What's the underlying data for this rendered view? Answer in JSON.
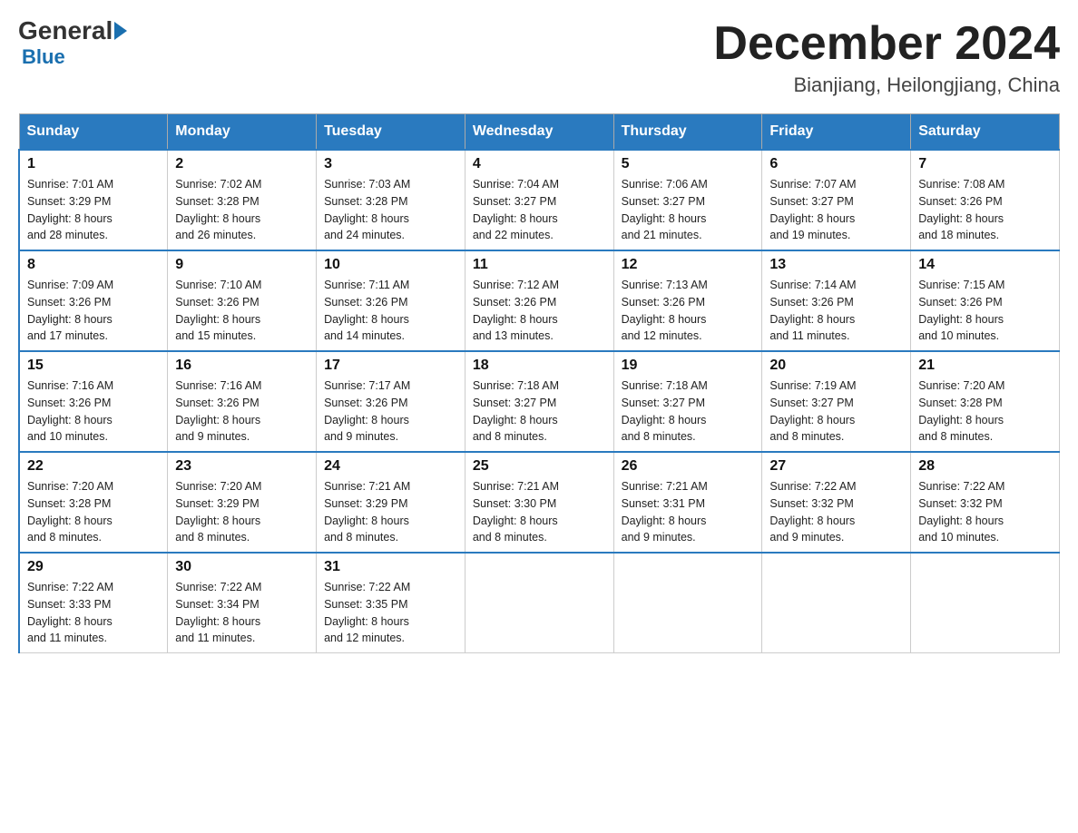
{
  "logo": {
    "general": "General",
    "blue": "Blue"
  },
  "header": {
    "title": "December 2024",
    "subtitle": "Bianjiang, Heilongjiang, China"
  },
  "days": [
    "Sunday",
    "Monday",
    "Tuesday",
    "Wednesday",
    "Thursday",
    "Friday",
    "Saturday"
  ],
  "weeks": [
    [
      {
        "day": "1",
        "sunrise": "7:01 AM",
        "sunset": "3:29 PM",
        "daylight": "8 hours and 28 minutes."
      },
      {
        "day": "2",
        "sunrise": "7:02 AM",
        "sunset": "3:28 PM",
        "daylight": "8 hours and 26 minutes."
      },
      {
        "day": "3",
        "sunrise": "7:03 AM",
        "sunset": "3:28 PM",
        "daylight": "8 hours and 24 minutes."
      },
      {
        "day": "4",
        "sunrise": "7:04 AM",
        "sunset": "3:27 PM",
        "daylight": "8 hours and 22 minutes."
      },
      {
        "day": "5",
        "sunrise": "7:06 AM",
        "sunset": "3:27 PM",
        "daylight": "8 hours and 21 minutes."
      },
      {
        "day": "6",
        "sunrise": "7:07 AM",
        "sunset": "3:27 PM",
        "daylight": "8 hours and 19 minutes."
      },
      {
        "day": "7",
        "sunrise": "7:08 AM",
        "sunset": "3:26 PM",
        "daylight": "8 hours and 18 minutes."
      }
    ],
    [
      {
        "day": "8",
        "sunrise": "7:09 AM",
        "sunset": "3:26 PM",
        "daylight": "8 hours and 17 minutes."
      },
      {
        "day": "9",
        "sunrise": "7:10 AM",
        "sunset": "3:26 PM",
        "daylight": "8 hours and 15 minutes."
      },
      {
        "day": "10",
        "sunrise": "7:11 AM",
        "sunset": "3:26 PM",
        "daylight": "8 hours and 14 minutes."
      },
      {
        "day": "11",
        "sunrise": "7:12 AM",
        "sunset": "3:26 PM",
        "daylight": "8 hours and 13 minutes."
      },
      {
        "day": "12",
        "sunrise": "7:13 AM",
        "sunset": "3:26 PM",
        "daylight": "8 hours and 12 minutes."
      },
      {
        "day": "13",
        "sunrise": "7:14 AM",
        "sunset": "3:26 PM",
        "daylight": "8 hours and 11 minutes."
      },
      {
        "day": "14",
        "sunrise": "7:15 AM",
        "sunset": "3:26 PM",
        "daylight": "8 hours and 10 minutes."
      }
    ],
    [
      {
        "day": "15",
        "sunrise": "7:16 AM",
        "sunset": "3:26 PM",
        "daylight": "8 hours and 10 minutes."
      },
      {
        "day": "16",
        "sunrise": "7:16 AM",
        "sunset": "3:26 PM",
        "daylight": "8 hours and 9 minutes."
      },
      {
        "day": "17",
        "sunrise": "7:17 AM",
        "sunset": "3:26 PM",
        "daylight": "8 hours and 9 minutes."
      },
      {
        "day": "18",
        "sunrise": "7:18 AM",
        "sunset": "3:27 PM",
        "daylight": "8 hours and 8 minutes."
      },
      {
        "day": "19",
        "sunrise": "7:18 AM",
        "sunset": "3:27 PM",
        "daylight": "8 hours and 8 minutes."
      },
      {
        "day": "20",
        "sunrise": "7:19 AM",
        "sunset": "3:27 PM",
        "daylight": "8 hours and 8 minutes."
      },
      {
        "day": "21",
        "sunrise": "7:20 AM",
        "sunset": "3:28 PM",
        "daylight": "8 hours and 8 minutes."
      }
    ],
    [
      {
        "day": "22",
        "sunrise": "7:20 AM",
        "sunset": "3:28 PM",
        "daylight": "8 hours and 8 minutes."
      },
      {
        "day": "23",
        "sunrise": "7:20 AM",
        "sunset": "3:29 PM",
        "daylight": "8 hours and 8 minutes."
      },
      {
        "day": "24",
        "sunrise": "7:21 AM",
        "sunset": "3:29 PM",
        "daylight": "8 hours and 8 minutes."
      },
      {
        "day": "25",
        "sunrise": "7:21 AM",
        "sunset": "3:30 PM",
        "daylight": "8 hours and 8 minutes."
      },
      {
        "day": "26",
        "sunrise": "7:21 AM",
        "sunset": "3:31 PM",
        "daylight": "8 hours and 9 minutes."
      },
      {
        "day": "27",
        "sunrise": "7:22 AM",
        "sunset": "3:32 PM",
        "daylight": "8 hours and 9 minutes."
      },
      {
        "day": "28",
        "sunrise": "7:22 AM",
        "sunset": "3:32 PM",
        "daylight": "8 hours and 10 minutes."
      }
    ],
    [
      {
        "day": "29",
        "sunrise": "7:22 AM",
        "sunset": "3:33 PM",
        "daylight": "8 hours and 11 minutes."
      },
      {
        "day": "30",
        "sunrise": "7:22 AM",
        "sunset": "3:34 PM",
        "daylight": "8 hours and 11 minutes."
      },
      {
        "day": "31",
        "sunrise": "7:22 AM",
        "sunset": "3:35 PM",
        "daylight": "8 hours and 12 minutes."
      },
      null,
      null,
      null,
      null
    ]
  ],
  "labels": {
    "sunrise": "Sunrise:",
    "sunset": "Sunset:",
    "daylight": "Daylight:"
  }
}
